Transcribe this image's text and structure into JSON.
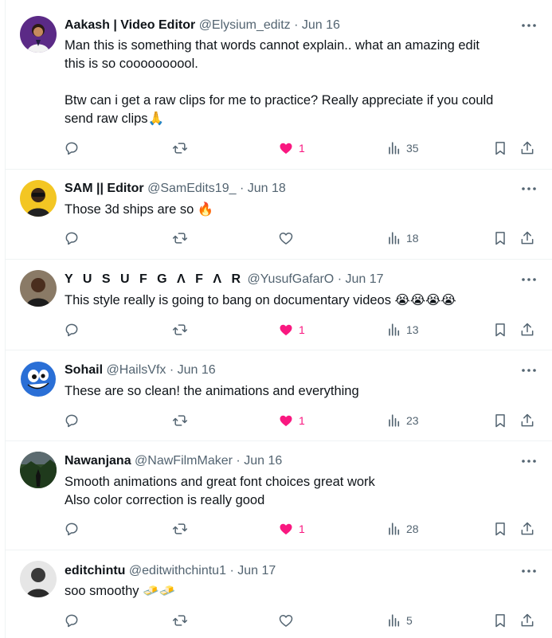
{
  "tweets": [
    {
      "name": "Aakash | Video Editor",
      "handle": "@Elysium_editz",
      "date": "Jun 16",
      "lines": [
        "Man this is something that words cannot explain.. what an amazing edit",
        "this is so coooooooool.",
        "",
        "Btw can i get a raw clips for me to practice? Really appreciate if you could",
        "send raw clips🙏"
      ],
      "liked": true,
      "likes": "1",
      "views": "35",
      "avatar_color": "#5b2a86"
    },
    {
      "name": "SAM || Editor",
      "handle": "@SamEdits19_",
      "date": "Jun 18",
      "lines": [
        "Those 3d ships are so 🔥"
      ],
      "liked": false,
      "likes": "",
      "views": "18",
      "avatar_color": "#f3c623"
    },
    {
      "name": "Y U S U F G Λ F Λ R",
      "handle": "@YusufGafarO",
      "date": "Jun 17",
      "lines": [
        "This style really is going to bang on documentary videos 😭😭😭😭"
      ],
      "liked": true,
      "likes": "1",
      "views": "13",
      "avatar_color": "#8a7a66"
    },
    {
      "name": "Sohail",
      "handle": "@HailsVfx",
      "date": "Jun 16",
      "lines": [
        "These are so clean! the animations and everything"
      ],
      "liked": true,
      "likes": "1",
      "views": "23",
      "avatar_color": "#2a6fd6"
    },
    {
      "name": "Nawanjana",
      "handle": "@NawFilmMaker",
      "date": "Jun 16",
      "lines": [
        "Smooth animations and great font choices great work",
        "Also color correction is really good"
      ],
      "liked": true,
      "likes": "1",
      "views": "28",
      "avatar_color": "#2f4a2a"
    },
    {
      "name": "editchintu",
      "handle": "@editwithchintu1",
      "date": "Jun 17",
      "lines": [
        "soo smoothy 🧈🧈"
      ],
      "liked": false,
      "likes": "",
      "views": "5",
      "avatar_color": "#3a3a3a"
    }
  ],
  "separator": "·",
  "colors": {
    "like_active": "#f91880",
    "muted": "#536471",
    "text": "#0f1419"
  },
  "icons": [
    "reply-icon",
    "retweet-icon",
    "like-icon",
    "views-icon",
    "bookmark-icon",
    "share-icon",
    "more-icon"
  ]
}
